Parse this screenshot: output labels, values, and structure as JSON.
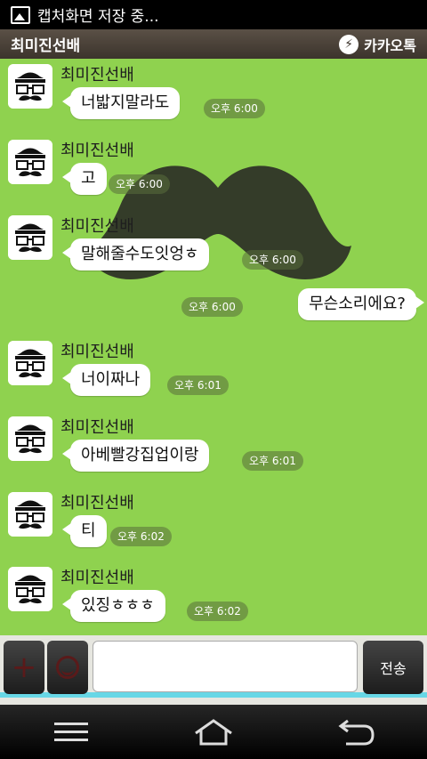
{
  "statusbar": {
    "text": "캡처화면 저장 중..."
  },
  "header": {
    "title": "최미진선배",
    "brand": "카카오톡"
  },
  "messages": [
    {
      "sender": "최미진선배",
      "text": "너밟지말라도",
      "time": "오후 6:00"
    },
    {
      "sender": "최미진선배",
      "text": "고",
      "time": "오후 6:00"
    },
    {
      "sender": "최미진선배",
      "text": "말해줄수도잇엉ㅎ",
      "time": "오후 6:00"
    },
    {
      "text": "무슨소리에요?",
      "time": "오후 6:00"
    },
    {
      "sender": "최미진선배",
      "text": "너이짜나",
      "time": "오후 6:01"
    },
    {
      "sender": "최미진선배",
      "text": "아베빨강집업이랑",
      "time": "오후 6:01"
    },
    {
      "sender": "최미진선배",
      "text": "티",
      "time": "오후 6:02"
    },
    {
      "sender": "최미진선배",
      "text": "있징ㅎㅎㅎ",
      "time": "오후 6:02"
    }
  ],
  "input": {
    "placeholder": "",
    "value": "",
    "send_label": "전송"
  },
  "icons": {
    "status": "image-icon",
    "brand": "kakaotalk-icon",
    "attach": "plus-icon",
    "emoticon": "smile-icon",
    "nav_menu": "menu-icon",
    "nav_home": "home-icon",
    "nav_back": "back-icon"
  },
  "colors": {
    "chat_bg": "#8fd24f",
    "titlebar": "#4a4036",
    "accent": "#67d7e6"
  }
}
